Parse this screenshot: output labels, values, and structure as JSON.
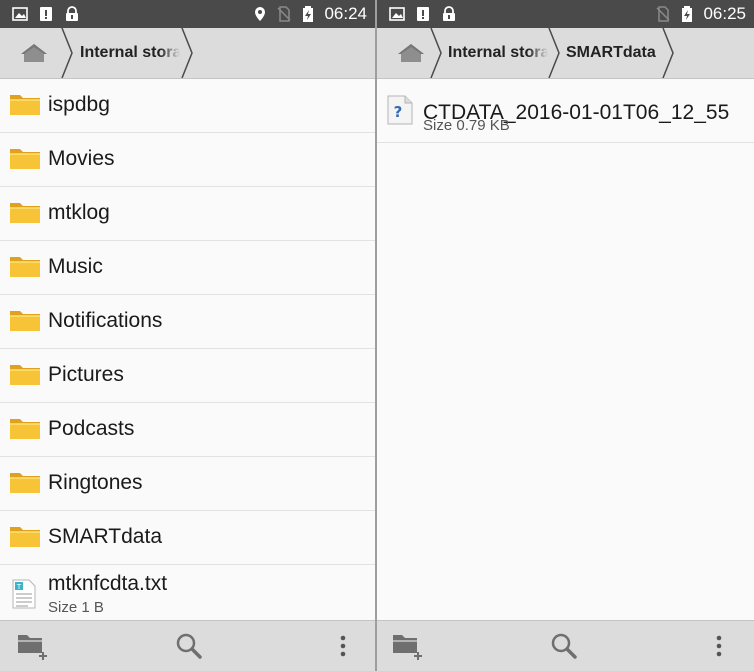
{
  "left": {
    "status": {
      "time": "06:24"
    },
    "breadcrumb": [
      {
        "label": "Internal stora",
        "truncated": true
      }
    ],
    "items": [
      {
        "type": "folder",
        "name": "ispdbg"
      },
      {
        "type": "folder",
        "name": "Movies"
      },
      {
        "type": "folder",
        "name": "mtklog"
      },
      {
        "type": "folder",
        "name": "Music"
      },
      {
        "type": "folder",
        "name": "Notifications"
      },
      {
        "type": "folder",
        "name": "Pictures"
      },
      {
        "type": "folder",
        "name": "Podcasts"
      },
      {
        "type": "folder",
        "name": "Ringtones"
      },
      {
        "type": "folder",
        "name": "SMARTdata"
      },
      {
        "type": "file",
        "name": "mtknfcdta.txt",
        "size": "Size 1 B",
        "icon": "text-file-icon"
      }
    ]
  },
  "right": {
    "status": {
      "time": "06:25"
    },
    "breadcrumb": [
      {
        "label": "Internal stora",
        "truncated": true
      },
      {
        "label": "SMARTdata",
        "truncated": false
      }
    ],
    "items": [
      {
        "type": "file",
        "name": "CTDATA_2016-01-01T06_12_55",
        "size": "Size 0.79 KB",
        "icon": "unknown-file-icon"
      }
    ]
  },
  "colors": {
    "status_bar": "#4a4a4a",
    "toolbar": "#dcdcdc",
    "list_bg": "#fafafa",
    "folder": "#f7c438",
    "icon_gray": "#6f6f6f"
  }
}
